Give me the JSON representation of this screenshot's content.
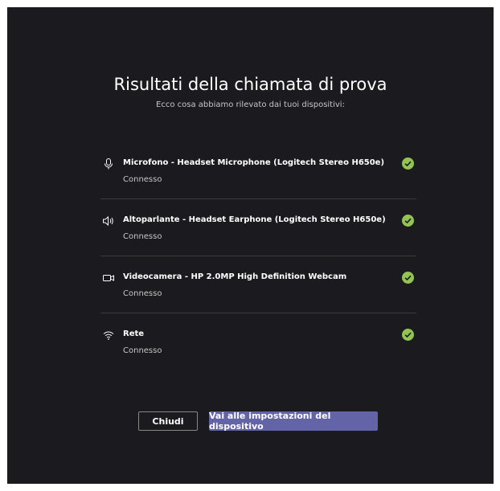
{
  "dialog": {
    "title": "Risultati della chiamata di prova",
    "subtitle": "Ecco cosa abbiamo rilevato dai tuoi dispositivi:"
  },
  "devices": [
    {
      "icon": "microphone-icon",
      "name": "Microfono - Headset Microphone (Logitech Stereo H650e)",
      "status": "Connesso"
    },
    {
      "icon": "speaker-icon",
      "name": "Altoparlante - Headset Earphone (Logitech Stereo H650e)",
      "status": "Connesso"
    },
    {
      "icon": "camera-icon",
      "name": "Videocamera - HP 2.0MP High Definition Webcam",
      "status": "Connesso"
    },
    {
      "icon": "wifi-icon",
      "name": "Rete",
      "status": "Connesso"
    }
  ],
  "buttons": {
    "close_label": "Chiudi",
    "settings_label": "Vai alle impostazioni del dispositivo"
  },
  "colors": {
    "background": "#1b1a1f",
    "accent": "#6264a7",
    "success": "#92c353",
    "divider": "#3b3a39"
  }
}
